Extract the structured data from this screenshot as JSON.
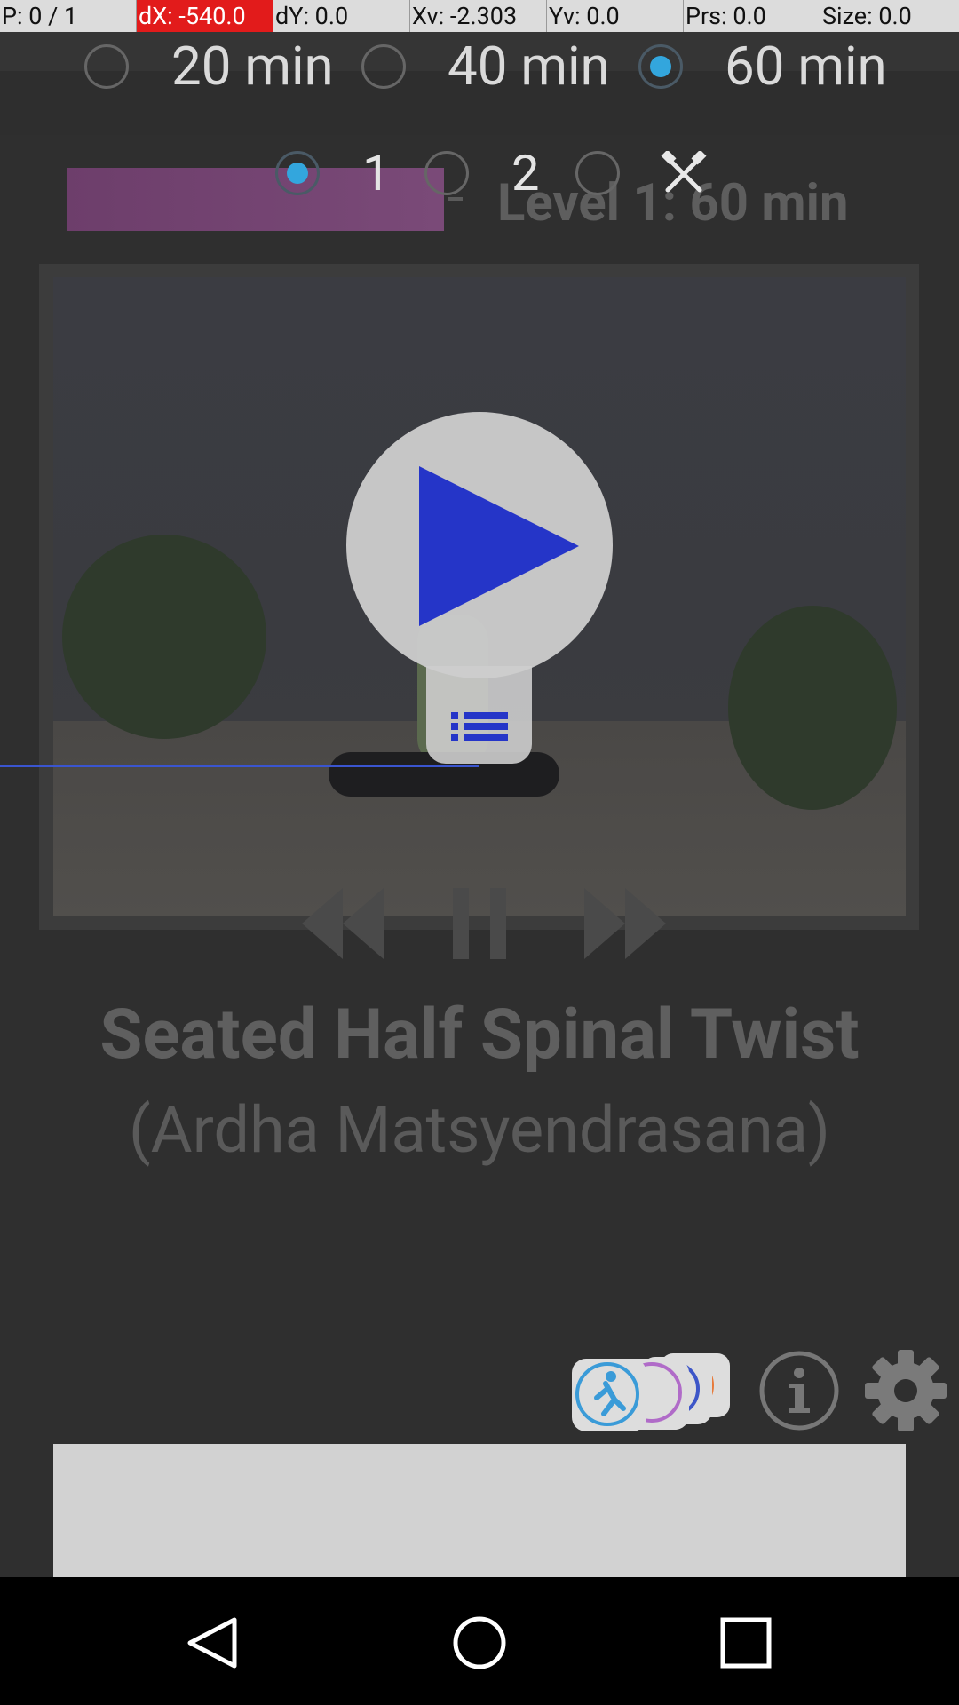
{
  "debug_bar": {
    "pointer": "P: 0 / 1",
    "dx": "dX: -540.0",
    "dy": "dY: 0.0",
    "xv": "Xv: -2.303",
    "yv": "Yv: 0.0",
    "prs": "Prs: 0.0",
    "size": "Size: 0.0"
  },
  "duration": {
    "options": [
      "20 min",
      "40 min",
      "60 min"
    ],
    "selected": "60 min"
  },
  "level": {
    "options": [
      "1",
      "2"
    ],
    "selected": "1",
    "title": "Level 1: 60 min",
    "progress_percent": 0
  },
  "exercise": {
    "name": "Seated Half Spinal Twist",
    "sanskrit": "(Ardha Matsyendrasana)"
  },
  "icons": {
    "tools": "tools-icon",
    "play": "play-icon",
    "list": "list-icon",
    "rewind": "rewind-icon",
    "pause": "pause-icon",
    "fast_forward": "fast-forward-icon",
    "apps": "more-apps-icon",
    "info": "info-icon",
    "settings": "gear-icon",
    "nav_back": "back-icon",
    "nav_home": "home-icon",
    "nav_recents": "recents-icon"
  },
  "colors": {
    "radio_selected": "#33a6dd",
    "play_triangle": "#2535c8",
    "progress": "#6d3e6b",
    "debug_highlight": "#e21b1b"
  }
}
